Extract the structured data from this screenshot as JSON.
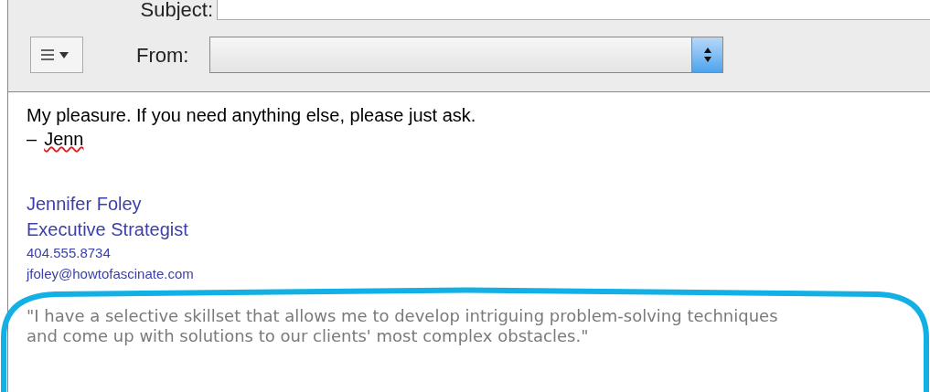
{
  "header": {
    "subject": {
      "label": "Subject:"
    },
    "from": {
      "label": "From:"
    }
  },
  "body": {
    "lines": [
      {
        "text": "My pleasure. If you need anything else, please just ask."
      },
      {
        "dash": "–",
        "text": "Jenn",
        "misspelled": true
      }
    ],
    "signature": {
      "name": "Jennifer Foley",
      "title": "Executive Strategist",
      "phone": "404.555.8734",
      "email": "jfoley@howtofascinate.com",
      "quote": "\"I have a selective skillset that allows me to develop intriguing problem-solving techniques and come up with solutions to our clients' most complex obstacles.\""
    }
  }
}
